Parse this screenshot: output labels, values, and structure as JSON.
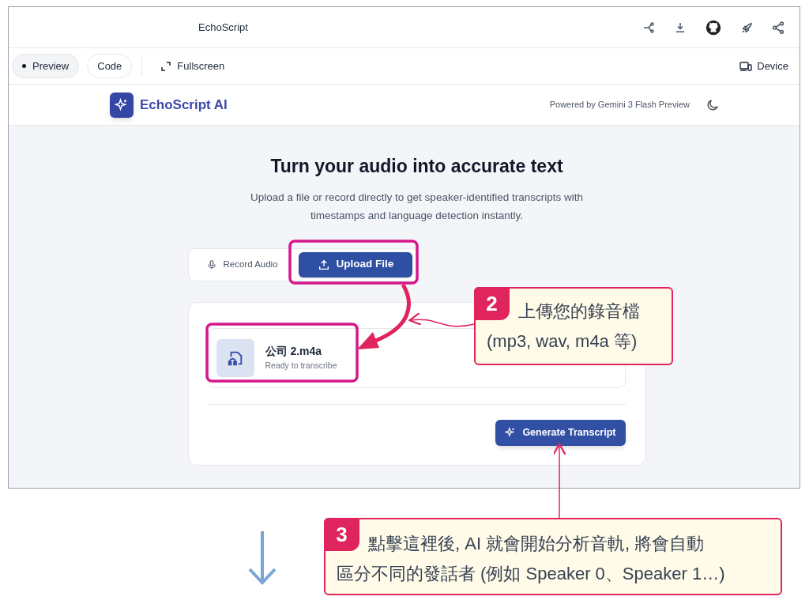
{
  "top_bar": {
    "title": "EchoScript"
  },
  "toolbar": {
    "tabs": [
      {
        "label": "Preview",
        "selected": true
      },
      {
        "label": "Code",
        "selected": false
      }
    ],
    "fullscreen": "Fullscreen",
    "device": "Device"
  },
  "app_header": {
    "brand": "EchoScript AI",
    "powered_by": "Powered by Gemini 3 Flash Preview"
  },
  "hero": {
    "heading": "Turn your audio into accurate text",
    "subtitle": "Upload a file or record directly to get speaker-identified transcripts with timestamps and language detection instantly."
  },
  "modes": [
    {
      "label": "Record Audio",
      "kind": "mic",
      "selected": false
    },
    {
      "label": "Upload File",
      "kind": "upload",
      "selected": true
    }
  ],
  "file": {
    "name": "公司 2.m4a",
    "status": "Ready to transcribe"
  },
  "generate_button": "Generate Transcript",
  "annotations": [
    {
      "number": "2",
      "lines": [
        "上傳您的錄音檔",
        "(mp3, wav, m4a 等)"
      ]
    },
    {
      "number": "3",
      "lines": [
        "點擊這裡後, AI 就會開始分析音軌, 將會自動",
        "區分不同的發話者 (例如 Speaker 0、Speaker 1…)"
      ]
    }
  ]
}
